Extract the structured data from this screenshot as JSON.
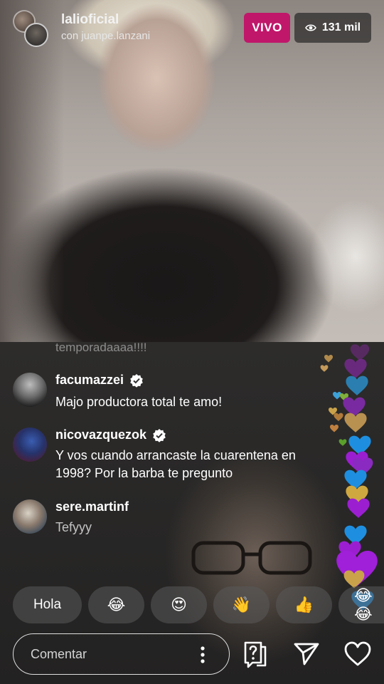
{
  "header": {
    "host_username": "lalioficial",
    "guest_line": "con juanpe.lanzani",
    "live_label": "VIVO",
    "viewer_count": "131 mil"
  },
  "comments": {
    "faded": "temporadaaaa!!!!",
    "items": [
      {
        "username": "facumazzei",
        "verified": true,
        "text": "Majo productora total te amo!"
      },
      {
        "username": "nicovazquezok",
        "verified": true,
        "text": "Y vos cuando arrancaste la cuarentena en 1998? Por la barba te pregunto"
      },
      {
        "username": "sere.martinf",
        "verified": false,
        "text": "Tefyyy"
      }
    ]
  },
  "quick_replies": [
    "Hola",
    "😂",
    "😍",
    "👋",
    "👍",
    "😂😂"
  ],
  "composer": {
    "placeholder": "Comentar"
  },
  "icons": [
    "eye-icon",
    "verified-icon",
    "more-icon",
    "question-icon",
    "send-icon",
    "heart-icon"
  ],
  "colors": {
    "live_badge": "#c0176a",
    "heart_purple": "#9b1fd1",
    "heart_blue": "#1e8fe0",
    "heart_gold": "#c9a24a"
  }
}
